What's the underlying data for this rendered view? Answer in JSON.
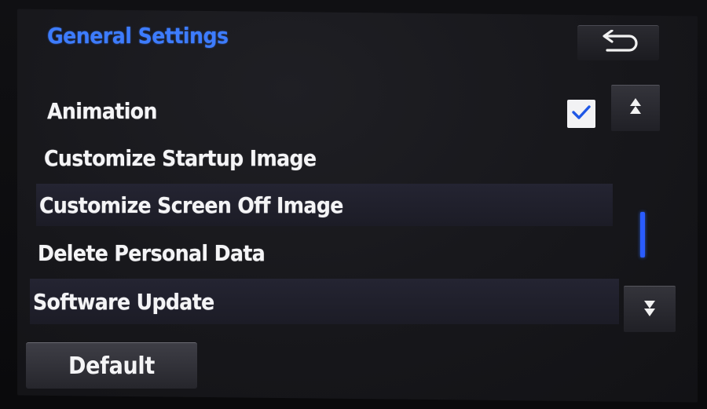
{
  "header": {
    "title": "General Settings",
    "back_icon": "return-arrow-icon"
  },
  "settings": {
    "items": [
      {
        "label": "Animation",
        "checked": true
      },
      {
        "label": "Customize Startup Image"
      },
      {
        "label": "Customize Screen Off Image"
      },
      {
        "label": "Delete Personal Data"
      },
      {
        "label": "Software Update"
      }
    ]
  },
  "scroll": {
    "up_icon": "scroll-up-icon",
    "down_icon": "scroll-down-icon"
  },
  "footer": {
    "default_label": "Default"
  },
  "colors": {
    "title_blue": "#3d7cff",
    "checkmark_blue": "#1f57e6",
    "scroll_thumb_blue": "#2a5cff",
    "background": "#17171b"
  }
}
